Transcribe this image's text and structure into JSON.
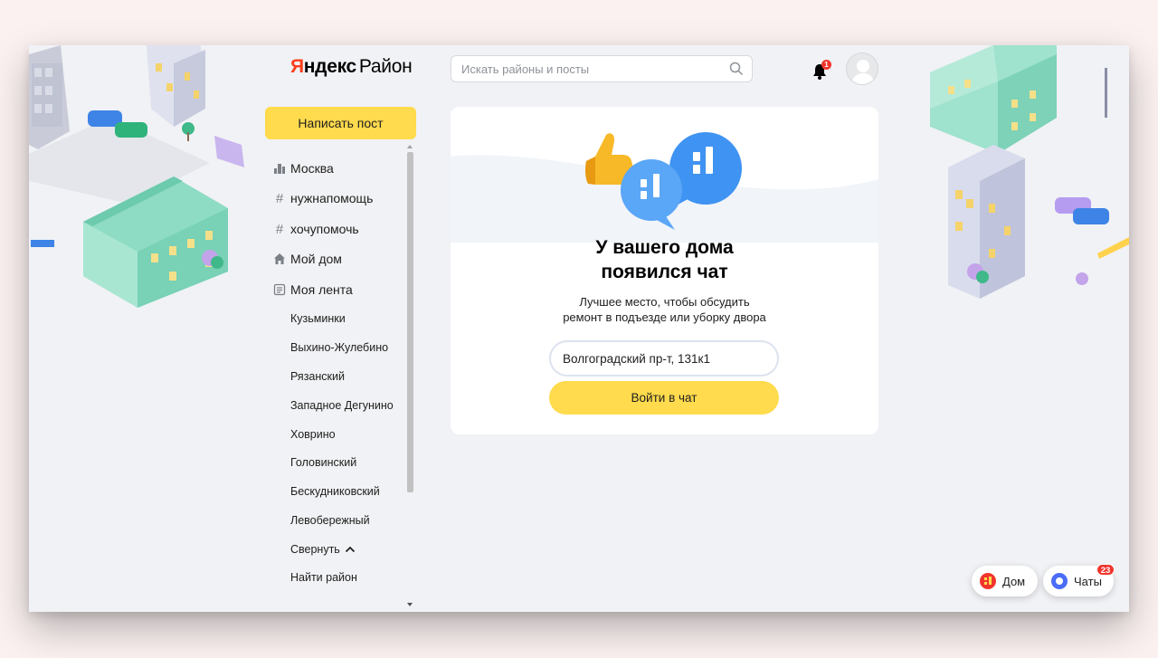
{
  "header": {
    "logo_yandex_first": "Я",
    "logo_yandex_rest": "ндекс",
    "logo_product": "Район",
    "search_placeholder": "Искать районы и посты",
    "notifications_count": "1"
  },
  "sidebar": {
    "write_post_label": "Написать пост",
    "items": [
      {
        "label": "Москва",
        "icon": "city-icon"
      },
      {
        "label": "нужнапомощь",
        "icon": "hashtag-icon"
      },
      {
        "label": "хочупомочь",
        "icon": "hashtag-icon"
      },
      {
        "label": "Мой дом",
        "icon": "home-icon"
      },
      {
        "label": "Моя лента",
        "icon": "feed-icon"
      }
    ],
    "districts": [
      "Кузьминки",
      "Выхино-Жулебино",
      "Рязанский",
      "Западное Дегунино",
      "Ховрино",
      "Головинский",
      "Бескудниковский",
      "Левобережный"
    ],
    "collapse_label": "Свернуть",
    "find_district_label": "Найти район"
  },
  "card": {
    "title_line1": "У вашего дома",
    "title_line2": "появился чат",
    "desc_line1": "Лучшее место, чтобы обсудить",
    "desc_line2": "ремонт в подъезде или уборку двора",
    "address_value": "Волгоградский пр-т, 131к1",
    "enter_chat_label": "Войти в чат"
  },
  "floating": {
    "home_label": "Дом",
    "chats_label": "Чаты",
    "chats_count": "23"
  },
  "colors": {
    "accent_yellow": "#ffdb4d",
    "brand_red": "#fc3f1d",
    "badge_red": "#f0352d",
    "background": "#f1f2f5"
  }
}
